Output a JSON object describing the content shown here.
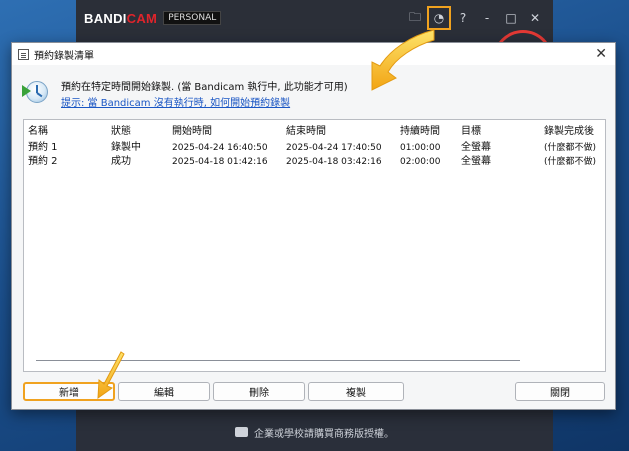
{
  "background_app": {
    "logo_main": "BANDI",
    "logo_accent": "CAM",
    "edition": "PERSONAL",
    "toolbar": {
      "folder_glyph": "🗀",
      "schedule_glyph": "◔",
      "help_glyph": "?",
      "minimize_glyph": "-",
      "restore_glyph": "□",
      "close_glyph": "✕"
    },
    "footer_text": "企業或學校請購買商務版授權。"
  },
  "dialog": {
    "title": "預約錄製清單",
    "close_glyph": "✕",
    "info_text": "預約在特定時間開始錄製. (當 Bandicam 執行中, 此功能才可用)",
    "info_link": "提示: 當 Bandicam 沒有執行時, 如何開始預約錄製",
    "list": {
      "columns": [
        "名稱",
        "狀態",
        "開始時間",
        "結束時間",
        "持續時間",
        "目標",
        "錄製完成後"
      ],
      "rows": [
        [
          "預約 1",
          "錄製中",
          "2025-04-24 16:40:50",
          "2025-04-24 17:40:50",
          "01:00:00",
          "全螢幕",
          "(什麼都不做)"
        ],
        [
          "預約 2",
          "成功",
          "2025-04-18 01:42:16",
          "2025-04-18 03:42:16",
          "02:00:00",
          "全螢幕",
          "(什麼都不做)"
        ]
      ]
    },
    "buttons": {
      "add": "新增",
      "edit": "編輯",
      "delete": "刪除",
      "copy": "複製",
      "close": "關閉"
    }
  },
  "colors": {
    "highlight": "#f0a21f",
    "link": "#1a56c4",
    "brand_red": "#e0242b"
  }
}
